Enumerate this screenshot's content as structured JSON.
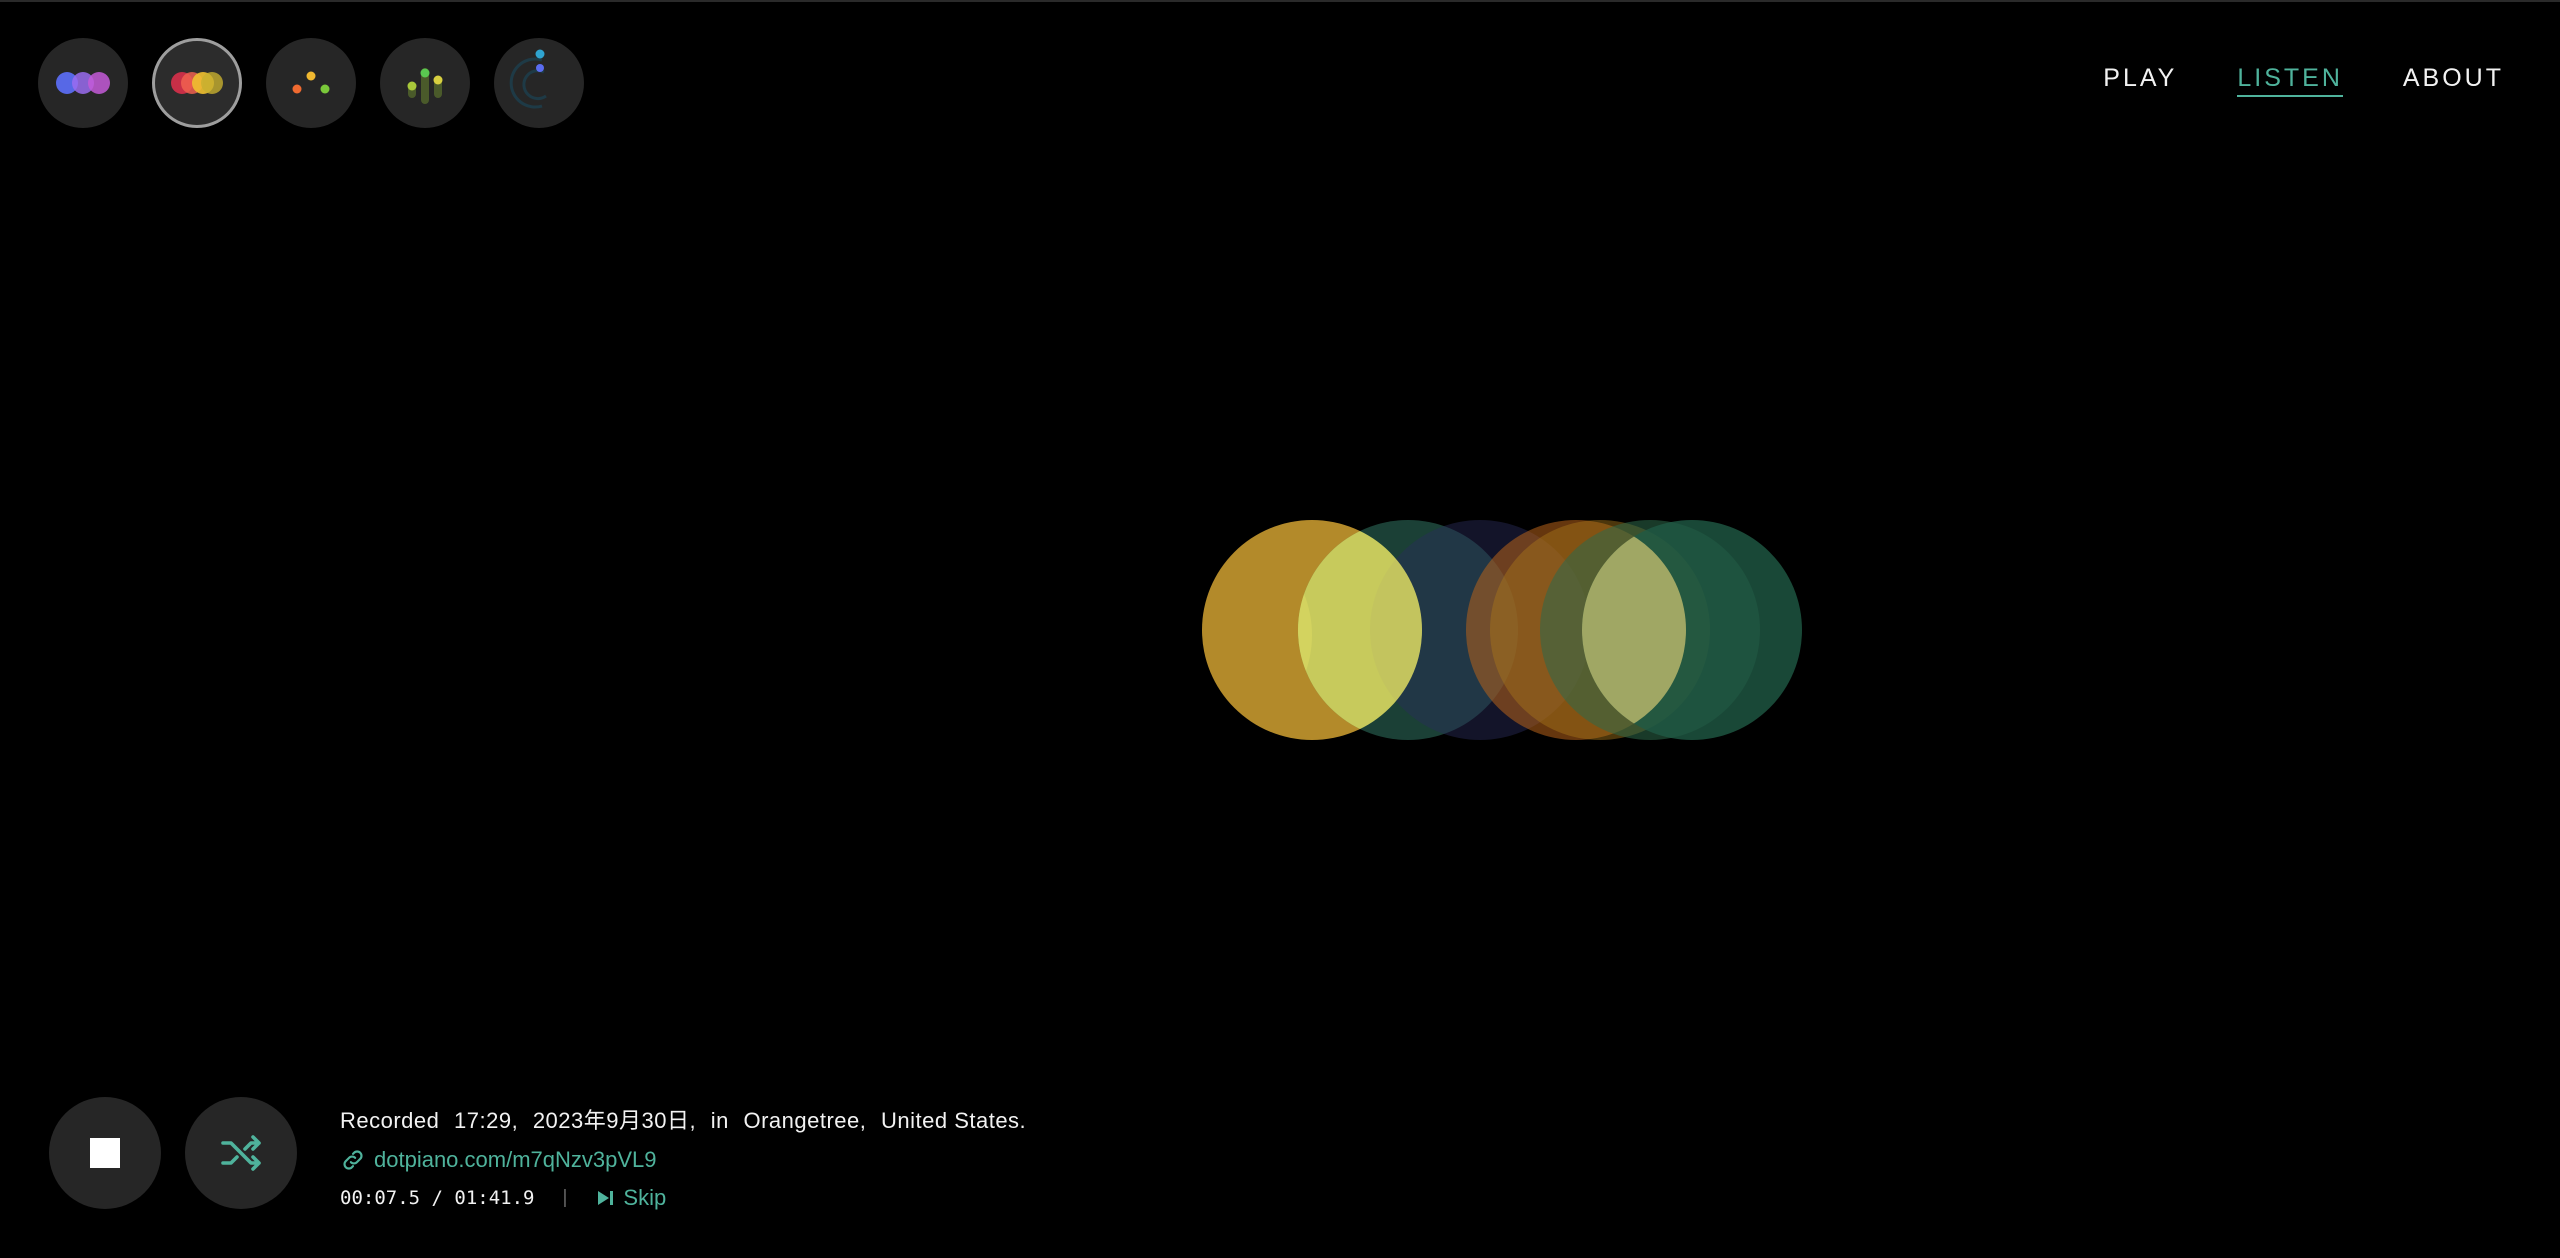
{
  "modes": [
    {
      "icon": "overlapping-circles-blue-purple-icon",
      "active": false
    },
    {
      "icon": "overlapping-circles-red-yellow-icon",
      "active": true
    },
    {
      "icon": "scattered-dots-icon",
      "active": false
    },
    {
      "icon": "dot-bars-icon",
      "active": false
    },
    {
      "icon": "orbit-arc-icon",
      "active": false
    }
  ],
  "nav": {
    "play": "PLAY",
    "listen": "LISTEN",
    "about": "ABOUT",
    "active": "listen"
  },
  "recording": {
    "prefix": "Recorded",
    "time": "17:29,",
    "date": "2023年9月30日,",
    "in": "in",
    "place": "Orangetree,",
    "country": "United States.",
    "link": "dotpiano.com/m7qNzv3pVL9",
    "elapsed": "00:07.5",
    "total": "01:41.9",
    "separator": "|",
    "skip": "Skip"
  },
  "colors": {
    "accent": "#4fb39c",
    "background": "#000000",
    "button": "#262626"
  },
  "controls": {
    "stop_icon": "stop-icon",
    "shuffle_icon": "shuffle-icon",
    "link_icon": "link-icon",
    "skip_icon": "skip-next-icon"
  }
}
